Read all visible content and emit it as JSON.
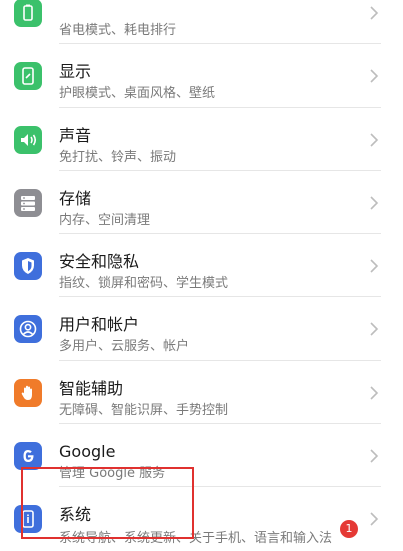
{
  "colors": {
    "battery": "#3bc16b",
    "display": "#3bc16b",
    "sound": "#3bc16b",
    "storage": "#8e8e93",
    "security": "#3f6fdc",
    "accounts": "#3f6fdc",
    "accessibility": "#f07b2a",
    "google": "#3f6fdc",
    "system": "#3f6fdc",
    "highlight": "#e0312f",
    "badge": "#e53935"
  },
  "items": [
    {
      "title": "",
      "subtitle": "省电模式、耗电排行",
      "icon": "battery-icon"
    },
    {
      "title": "显示",
      "subtitle": "护眼模式、桌面风格、壁纸",
      "icon": "display-icon"
    },
    {
      "title": "声音",
      "subtitle": "免打扰、铃声、振动",
      "icon": "speaker-icon"
    },
    {
      "title": "存储",
      "subtitle": "内存、空间清理",
      "icon": "storage-icon"
    },
    {
      "title": "安全和隐私",
      "subtitle": "指纹、锁屏和密码、学生模式",
      "icon": "shield-icon"
    },
    {
      "title": "用户和帐户",
      "subtitle": "多用户、云服务、帐户",
      "icon": "user-icon"
    },
    {
      "title": "智能辅助",
      "subtitle": "无障碍、智能识屏、手势控制",
      "icon": "hand-icon"
    },
    {
      "title": "Google",
      "subtitle": "管理 Google 服务",
      "icon": "google-icon"
    },
    {
      "title": "系统",
      "subtitle": "系统导航、系统更新、关于手机、语言和输入法",
      "icon": "phone-info-icon",
      "badge": "1"
    }
  ]
}
